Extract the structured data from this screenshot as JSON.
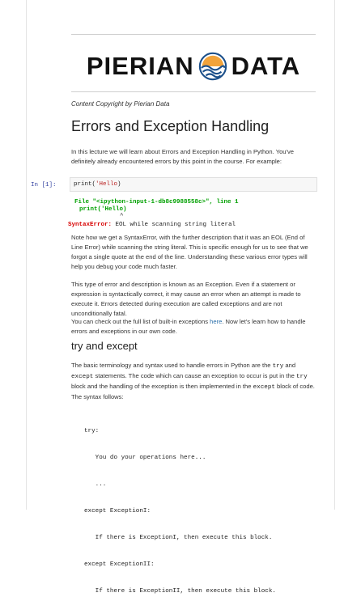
{
  "prompt": "In [1]:",
  "logo": {
    "word_left": "PIERIAN",
    "word_right": "DATA",
    "mark": "pierian-wave-logo"
  },
  "copyright": "Content Copyright by Pierian Data",
  "title": "Errors and Exception Handling",
  "intro": "In this lecture we will learn about Errors and Exception Handling in Python. You've definitely already encountered errors by this point in the course. For example:",
  "cell": {
    "code_fn": "print(",
    "code_str": "'Hello",
    "code_end": ")"
  },
  "traceback": {
    "line1_file": "File \"<ipython-input-1-db8c9988558c>\"",
    "line1_sep": ", line ",
    "line1_no": "1",
    "line2": "print('Hello)",
    "caret": "^",
    "error_name": "SyntaxError:",
    "error_msg": " EOL while scanning string literal"
  },
  "para2": "Note how we get a SyntaxError, with the further description that it was an EOL (End of Line Error) while scanning the string literal. This is specific enough for us to see that we forgot a single quote at the end of the line. Understanding these various error types will help you debug your code much faster.",
  "para3": "This type of error and description is known as an Exception. Even if a statement or expression is syntactically correct, it may cause an error when an attempt is made to execute it. Errors detected during execution are called exceptions and are not unconditionally fatal.",
  "para4": {
    "before": "You can check out the full list of built-in exceptions ",
    "link": "here",
    "after": ". Now let's learn how to handle errors and exceptions in our own code."
  },
  "section_title": "try and except",
  "para5": {
    "t1": "The basic terminology and syntax used to handle errors in Python are the ",
    "k1": "try",
    "t2": " and ",
    "k2": "except",
    "t3": " statements. The code which can cause an exception to occur is put in the ",
    "k3": "try",
    "t4": " block and the handling of the exception is then implemented in the ",
    "k4": "except",
    "t5": " block of code. The syntax follows:"
  },
  "syntax_lines": [
    "try:",
    "   You do your operations here...",
    "   ...",
    "except ExceptionI:",
    "   If there is ExceptionI, then execute this block.",
    "except ExceptionII:",
    "   If there is ExceptionII, then execute this block."
  ],
  "colors": {
    "prompt": "#303f9f",
    "string": "#ba2121",
    "traceback_green": "#00a000",
    "error_red": "#d70000",
    "link": "#296eaa",
    "logo_blue": "#1b4f8a",
    "logo_orange": "#f2a33a"
  }
}
